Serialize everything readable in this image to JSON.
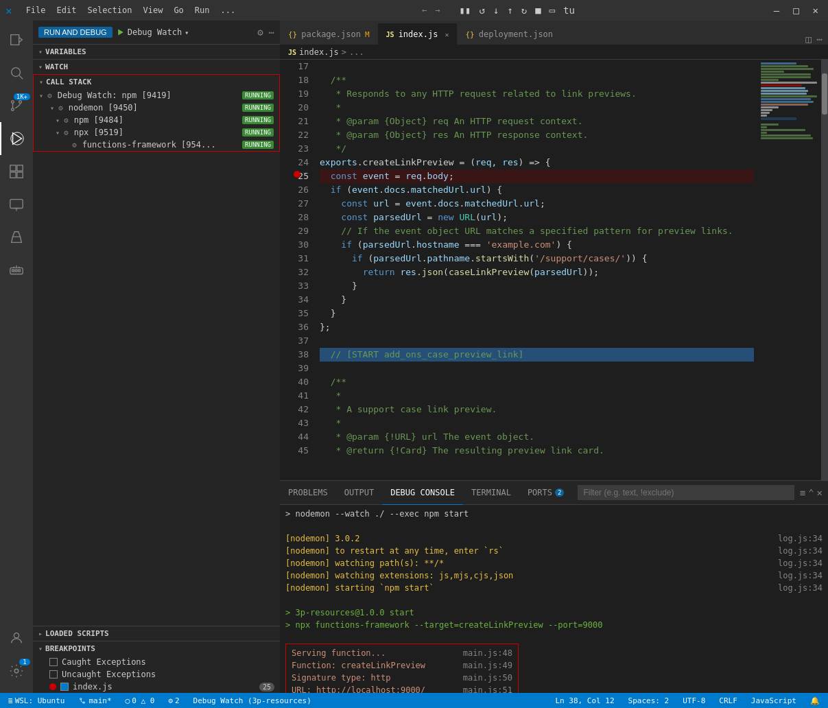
{
  "titleBar": {
    "menus": [
      "File",
      "Edit",
      "Selection",
      "View",
      "Go",
      "Run",
      "..."
    ],
    "windowControls": [
      "─",
      "□",
      "✕"
    ]
  },
  "debugToolbar": {
    "buttons": [
      "⏸",
      "⏸",
      "↺",
      "↓",
      "↑",
      "⟳",
      "□",
      "▽",
      "tu"
    ]
  },
  "activityBar": {
    "items": [
      {
        "name": "explorer",
        "icon": "📄",
        "active": false
      },
      {
        "name": "search",
        "icon": "🔍",
        "active": false
      },
      {
        "name": "source-control",
        "icon": "⎇",
        "active": false
      },
      {
        "name": "run-debug",
        "icon": "▶",
        "active": true
      },
      {
        "name": "extensions",
        "icon": "⊞",
        "active": false
      },
      {
        "name": "remote-explorer",
        "icon": "🖥",
        "active": false
      },
      {
        "name": "test",
        "icon": "⚗",
        "active": false
      },
      {
        "name": "docker",
        "icon": "🐋",
        "active": false
      }
    ],
    "bottomItems": [
      {
        "name": "accounts",
        "icon": "👤"
      },
      {
        "name": "settings",
        "icon": "⚙",
        "badge": "1"
      }
    ]
  },
  "sidebar": {
    "runDebugLabel": "RUN AND DEBUG",
    "runBtn": "RUN AND DEBUG",
    "debugConfig": "Debug Watch",
    "sections": {
      "variables": "VARIABLES",
      "watch": "WATCH",
      "callStack": {
        "label": "CALL STACK",
        "items": [
          {
            "label": "Debug Watch: npm [9419]",
            "level": 1,
            "status": "RUNNING",
            "children": [
              {
                "label": "nodemon [9450]",
                "level": 2,
                "status": "RUNNING"
              },
              {
                "label": "npm [9484]",
                "level": 3,
                "status": "RUNNING"
              },
              {
                "label": "npx [9519]",
                "level": 3,
                "status": "RUNNING",
                "children": [
                  {
                    "label": "functions-framework [954...",
                    "level": 4,
                    "status": "RUNNING"
                  }
                ]
              }
            ]
          }
        ]
      },
      "loadedScripts": "LOADED SCRIPTS",
      "breakpoints": {
        "label": "BREAKPOINTS",
        "items": [
          {
            "label": "Caught Exceptions",
            "type": "checkbox",
            "checked": false
          },
          {
            "label": "Uncaught Exceptions",
            "type": "checkbox",
            "checked": false
          },
          {
            "label": "index.js",
            "type": "dot",
            "checked": true,
            "badge": "25"
          }
        ]
      }
    }
  },
  "tabs": [
    {
      "label": "package.json",
      "modifier": "M",
      "icon": "{}",
      "active": false,
      "closable": false
    },
    {
      "label": "index.js",
      "icon": "JS",
      "active": true,
      "closable": true
    },
    {
      "label": "deployment.json",
      "icon": "{}",
      "active": false,
      "closable": false
    }
  ],
  "breadcrumb": {
    "parts": [
      "JS index.js",
      ">",
      "..."
    ]
  },
  "code": {
    "startLine": 17,
    "lines": [
      {
        "num": 17,
        "text": "",
        "type": "normal"
      },
      {
        "num": 18,
        "text": "  /**",
        "type": "comment"
      },
      {
        "num": 19,
        "text": "   * Responds to any HTTP request related to link previews.",
        "type": "comment"
      },
      {
        "num": 20,
        "text": "   *",
        "type": "comment"
      },
      {
        "num": 21,
        "text": "   * @param {Object} req An HTTP request context.",
        "type": "comment"
      },
      {
        "num": 22,
        "text": "   * @param {Object} res An HTTP response context.",
        "type": "comment"
      },
      {
        "num": 23,
        "text": "   */",
        "type": "comment"
      },
      {
        "num": 24,
        "text": "exports.createLinkPreview = (req, res) => {",
        "type": "normal"
      },
      {
        "num": 25,
        "text": "  const event = req.body;",
        "type": "breakpoint",
        "hasBreakpoint": true
      },
      {
        "num": 26,
        "text": "  if (event.docs.matchedUrl.url) {",
        "type": "normal"
      },
      {
        "num": 27,
        "text": "    const url = event.docs.matchedUrl.url;",
        "type": "normal"
      },
      {
        "num": 28,
        "text": "    const parsedUrl = new URL(url);",
        "type": "normal"
      },
      {
        "num": 29,
        "text": "    // If the event object URL matches a specified pattern for preview links.",
        "type": "comment"
      },
      {
        "num": 30,
        "text": "    if (parsedUrl.hostname === 'example.com') {",
        "type": "normal"
      },
      {
        "num": 31,
        "text": "      if (parsedUrl.pathname.startsWith('/support/cases/')) {",
        "type": "normal"
      },
      {
        "num": 32,
        "text": "        return res.json(caseLinkPreview(parsedUrl));",
        "type": "normal"
      },
      {
        "num": 33,
        "text": "      }",
        "type": "normal"
      },
      {
        "num": 34,
        "text": "    }",
        "type": "normal"
      },
      {
        "num": 35,
        "text": "  }",
        "type": "normal"
      },
      {
        "num": 36,
        "text": "};",
        "type": "normal"
      },
      {
        "num": 37,
        "text": "",
        "type": "normal"
      },
      {
        "num": 38,
        "text": "  // [START add_ons_case_preview_link]",
        "type": "highlighted"
      },
      {
        "num": 39,
        "text": "",
        "type": "normal"
      },
      {
        "num": 40,
        "text": "  /**",
        "type": "comment"
      },
      {
        "num": 41,
        "text": "   *",
        "type": "comment"
      },
      {
        "num": 42,
        "text": "   * A support case link preview.",
        "type": "comment"
      },
      {
        "num": 43,
        "text": "   *",
        "type": "comment"
      },
      {
        "num": 44,
        "text": "   * @param {!URL} url The event object.",
        "type": "comment"
      },
      {
        "num": 45,
        "text": "   * @return {!Card} The resulting preview link card.",
        "type": "comment"
      }
    ]
  },
  "panel": {
    "tabs": [
      "PROBLEMS",
      "OUTPUT",
      "DEBUG CONSOLE",
      "TERMINAL",
      "PORTS"
    ],
    "activeTab": "DEBUG CONSOLE",
    "portsCount": "2",
    "filterPlaceholder": "Filter (e.g. text, !exclude)",
    "consoleLines": [
      {
        "type": "prompt",
        "text": "> nodemon --watch ./ --exec npm start",
        "right": ""
      },
      {
        "type": "blank",
        "text": "",
        "right": ""
      },
      {
        "type": "yellow",
        "text": "[nodemon] 3.0.2",
        "right": "log.js:34"
      },
      {
        "type": "yellow",
        "text": "[nodemon] to restart at any time, enter `rs`",
        "right": "log.js:34"
      },
      {
        "type": "yellow",
        "text": "[nodemon] watching path(s): **/*",
        "right": "log.js:34"
      },
      {
        "type": "yellow",
        "text": "[nodemon] watching extensions: js,mjs,cjs,json",
        "right": "log.js:34"
      },
      {
        "type": "yellow",
        "text": "[nodemon] starting `npm start`",
        "right": "log.js:34"
      },
      {
        "type": "blank",
        "text": "",
        "right": "log.js:34"
      },
      {
        "type": "green",
        "text": "> 3p-resources@1.0.0 start",
        "right": ""
      },
      {
        "type": "green",
        "text": "> npx functions-framework --target=createLinkPreview --port=9000",
        "right": ""
      },
      {
        "type": "blank",
        "text": "",
        "right": ""
      },
      {
        "type": "highlighted-serving",
        "lines": [
          {
            "text": "Serving function...",
            "right": "main.js:48"
          },
          {
            "text": "Function: createLinkPreview",
            "right": "main.js:49"
          },
          {
            "text": "Signature type: http",
            "right": "main.js:50"
          },
          {
            "text": "URL: http://localhost:9000/",
            "right": "main.js:51"
          }
        ]
      }
    ]
  },
  "statusBar": {
    "left": [
      {
        "label": "WSL: Ubuntu",
        "icon": "remote"
      },
      {
        "label": "main*",
        "icon": "branch"
      },
      {
        "label": "⓪ 0 △ 0"
      },
      {
        "label": "⚙ 2"
      },
      {
        "label": "Debug Watch (3p-resources)"
      }
    ],
    "right": [
      {
        "label": "Ln 38, Col 12"
      },
      {
        "label": "Spaces: 2"
      },
      {
        "label": "UTF-8"
      },
      {
        "label": "CRLF"
      },
      {
        "label": "JavaScript"
      }
    ]
  }
}
